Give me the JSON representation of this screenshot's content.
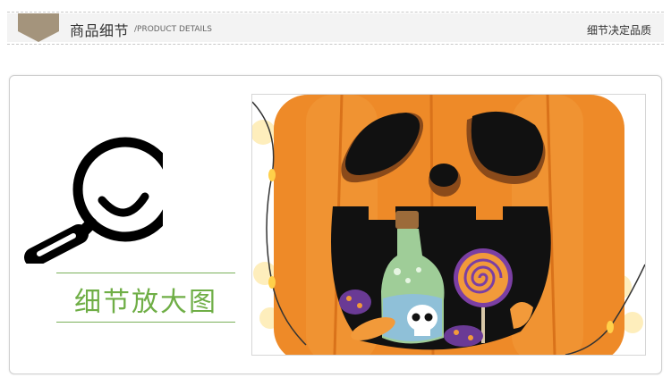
{
  "header": {
    "title": "商品细节",
    "subtitle": "/PRODUCT DETAILS",
    "slogan": "细节决定品质",
    "ribbon_color": "#a4947c"
  },
  "detail": {
    "label": "细节放大图",
    "label_color": "#6fae46",
    "icon": "magnifier-icon"
  },
  "photo": {
    "subject": "pumpkin-candy-illustration"
  }
}
